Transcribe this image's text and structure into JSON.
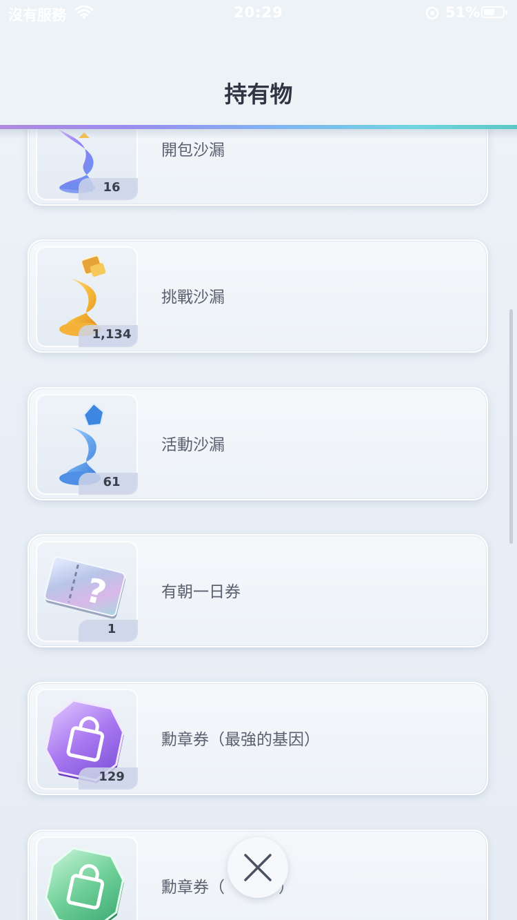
{
  "status_bar": {
    "carrier": "沒有服務",
    "time": "20:29",
    "battery": "51%",
    "battery_level": 0.51
  },
  "header": {
    "title": "持有物"
  },
  "items": [
    {
      "name": "開包沙漏",
      "count": "16",
      "icon": "hourglass-purple-icon"
    },
    {
      "name": "挑戰沙漏",
      "count": "1,134",
      "icon": "hourglass-gold-icon"
    },
    {
      "name": "活動沙漏",
      "count": "61",
      "icon": "hourglass-blue-icon"
    },
    {
      "name": "有朝一日券",
      "count": "1",
      "icon": "mystery-ticket-icon"
    },
    {
      "name": "勳章券（最強的基因）",
      "count": "129",
      "icon": "purple-medal-ticket-icon"
    },
    {
      "name": "勳章券（",
      "visible_suffix": "）",
      "count": "",
      "icon": "green-medal-ticket-icon"
    }
  ],
  "close_button": {
    "icon": "close-icon"
  },
  "colors": {
    "accent_gradient": [
      "#b08adf",
      "#7fb6f2",
      "#5cc8c4"
    ],
    "background": "#eaf0f6"
  }
}
